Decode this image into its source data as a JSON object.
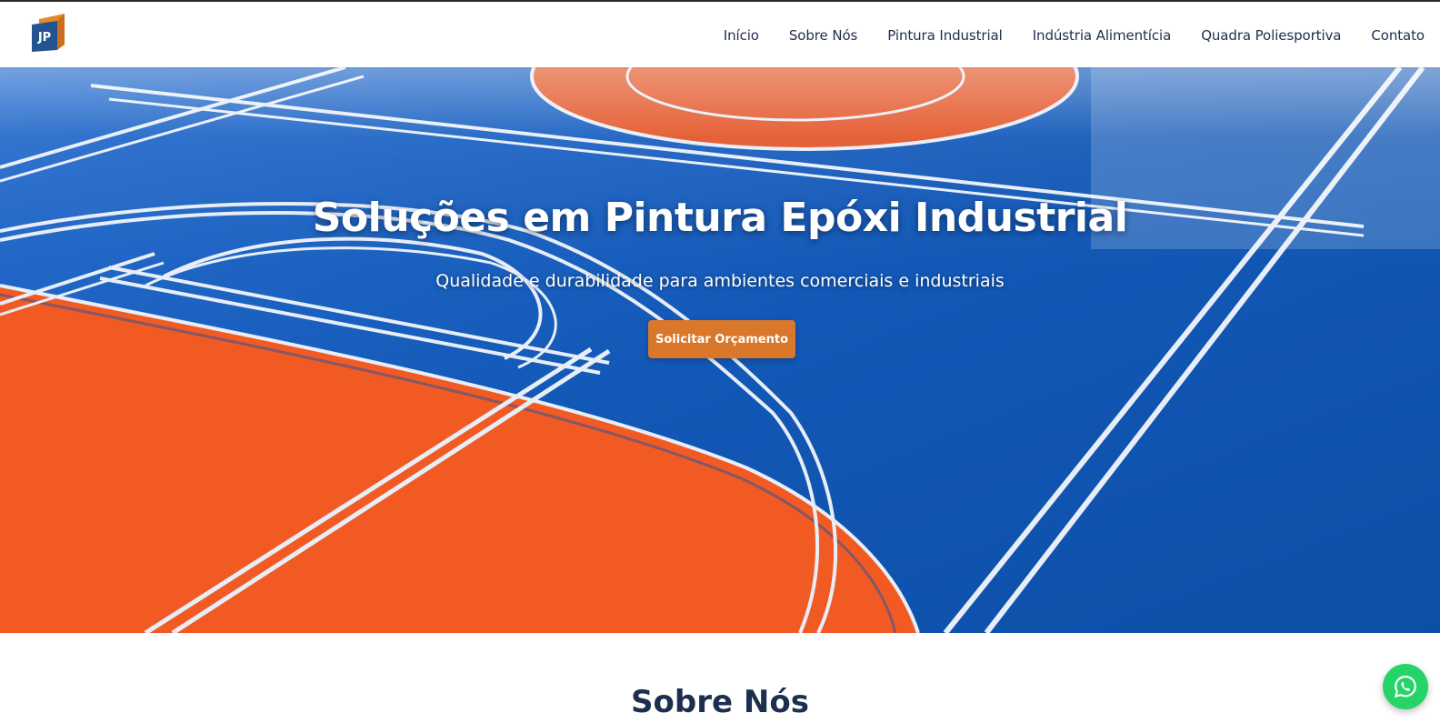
{
  "header": {
    "logo_text": "JP",
    "nav": [
      {
        "label": "Início"
      },
      {
        "label": "Sobre Nós"
      },
      {
        "label": "Pintura Industrial"
      },
      {
        "label": "Indústria Alimentícia"
      },
      {
        "label": "Quadra Poliesportiva"
      },
      {
        "label": "Contato"
      }
    ]
  },
  "hero": {
    "title": "Soluções em Pintura Epóxi Industrial",
    "subtitle": "Qualidade e durabilidade para ambientes comerciais e industriais",
    "cta_label": "Solicitar Orçamento"
  },
  "section": {
    "title": "Sobre Nós"
  },
  "floating": {
    "icon": "whatsapp-icon"
  },
  "colors": {
    "navy": "#1f2d4d",
    "accent_orange": "#d9772b",
    "court_blue": "#1559b8",
    "court_orange": "#f05a24",
    "whatsapp_green": "#25d366"
  }
}
